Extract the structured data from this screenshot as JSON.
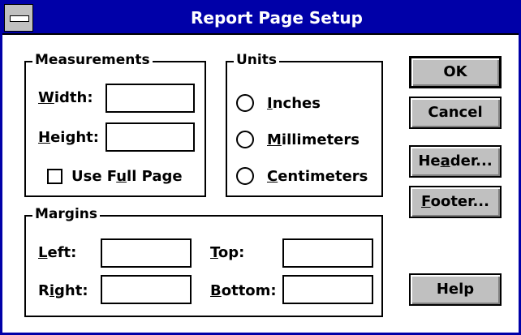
{
  "window": {
    "title": "Report Page Setup"
  },
  "measurements": {
    "label": "Measurements",
    "width_label_u": "W",
    "width_label_rest": "idth:",
    "width_value": "",
    "height_label_u": "H",
    "height_label_rest": "eight:",
    "height_value": "",
    "use_full_page_pre": "Use F",
    "use_full_page_u": "u",
    "use_full_page_post": "ll Page",
    "use_full_page_checked": false
  },
  "units": {
    "label": "Units",
    "options": [
      {
        "u": "I",
        "rest": "nches",
        "selected": false
      },
      {
        "u": "M",
        "rest": "illimeters",
        "selected": false
      },
      {
        "u": "C",
        "rest": "entimeters",
        "selected": false
      }
    ]
  },
  "margins": {
    "label": "Margins",
    "left_u": "L",
    "left_rest": "eft:",
    "left_value": "",
    "top_u": "T",
    "top_rest": "op:",
    "top_value": "",
    "right_pre": "R",
    "right_u": "i",
    "right_rest": "ght:",
    "right_value": "",
    "bottom_u": "B",
    "bottom_rest": "ottom:",
    "bottom_value": ""
  },
  "buttons": {
    "ok": "OK",
    "cancel": "Cancel",
    "header_pre": "He",
    "header_u": "a",
    "header_post": "der...",
    "footer_u": "F",
    "footer_post": "ooter...",
    "help": "Help"
  },
  "colors": {
    "title_bar": "#0000a8",
    "button_face": "#c0c0c0"
  }
}
